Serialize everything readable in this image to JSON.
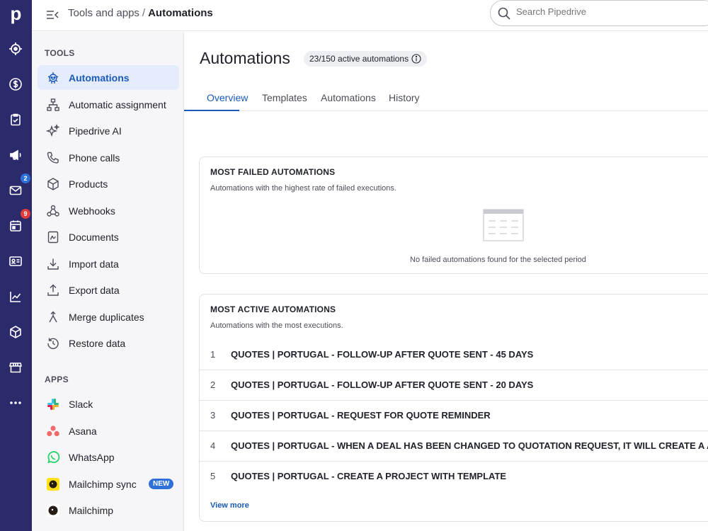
{
  "rail": {
    "logo": "p",
    "items": [
      {
        "icon": "target-icon"
      },
      {
        "icon": "dollar-icon"
      },
      {
        "icon": "clipboard-check-icon"
      },
      {
        "icon": "megaphone-icon"
      },
      {
        "icon": "mail-icon",
        "badge": "2",
        "badge_color": "#2e6fd8"
      },
      {
        "icon": "calendar-icon",
        "badge": "9",
        "badge_color": "#e03c3c"
      },
      {
        "icon": "contact-card-icon"
      },
      {
        "icon": "chart-line-icon"
      },
      {
        "icon": "box-icon"
      },
      {
        "icon": "store-icon"
      },
      {
        "icon": "more-dots-icon"
      }
    ]
  },
  "header": {
    "breadcrumb_parent": "Tools and apps",
    "breadcrumb_sep": "/",
    "breadcrumb_current": "Automations",
    "search_placeholder": "Search Pipedrive"
  },
  "sidebar": {
    "tools_title": "TOOLS",
    "tools": [
      {
        "label": "Automations",
        "icon": "robot-icon",
        "active": true
      },
      {
        "label": "Automatic assignment",
        "icon": "assignment-tree-icon"
      },
      {
        "label": "Pipedrive AI",
        "icon": "sparkles-icon"
      },
      {
        "label": "Phone calls",
        "icon": "phone-icon"
      },
      {
        "label": "Products",
        "icon": "box-icon"
      },
      {
        "label": "Webhooks",
        "icon": "webhook-icon"
      },
      {
        "label": "Documents",
        "icon": "document-icon"
      },
      {
        "label": "Import data",
        "icon": "download-icon"
      },
      {
        "label": "Export data",
        "icon": "upload-icon"
      },
      {
        "label": "Merge duplicates",
        "icon": "merge-icon"
      },
      {
        "label": "Restore data",
        "icon": "restore-icon"
      }
    ],
    "apps_title": "APPS",
    "apps": [
      {
        "label": "Slack",
        "icon": "slack-icon"
      },
      {
        "label": "Asana",
        "icon": "asana-icon"
      },
      {
        "label": "WhatsApp",
        "icon": "whatsapp-icon"
      },
      {
        "label": "Mailchimp sync",
        "icon": "mailchimp-icon",
        "badge": "NEW"
      },
      {
        "label": "Mailchimp",
        "icon": "mailchimp-icon"
      }
    ]
  },
  "main": {
    "title": "Automations",
    "active_count": "23/150 active automations",
    "tabs": [
      "Overview",
      "Templates",
      "Automations",
      "History"
    ],
    "failed_card": {
      "title": "MOST FAILED AUTOMATIONS",
      "subtitle": "Automations with the highest rate of failed executions.",
      "empty_text": "No failed automations found for the selected period"
    },
    "active_card": {
      "title": "MOST ACTIVE AUTOMATIONS",
      "subtitle": "Automations with the most executions.",
      "rows": [
        {
          "num": "1",
          "name": "QUOTES | PORTUGAL - FOLLOW-UP AFTER QUOTE SENT - 45 DAYS"
        },
        {
          "num": "2",
          "name": "QUOTES | PORTUGAL - FOLLOW-UP AFTER QUOTE SENT - 20 DAYS"
        },
        {
          "num": "3",
          "name": "QUOTES | PORTUGAL - REQUEST FOR QUOTE REMINDER"
        },
        {
          "num": "4",
          "name": "QUOTES | PORTUGAL - WHEN A DEAL HAS BEEN CHANGED TO QUOTATION REQUEST, IT WILL CREATE A ACTIVITY"
        },
        {
          "num": "5",
          "name": "QUOTES | PORTUGAL - CREATE A PROJECT WITH TEMPLATE"
        }
      ],
      "view_more": "View more"
    }
  },
  "colors": {
    "rail": "#2b2a6b",
    "accent": "#1a5ab8",
    "active_bg": "#e4ecfb"
  }
}
